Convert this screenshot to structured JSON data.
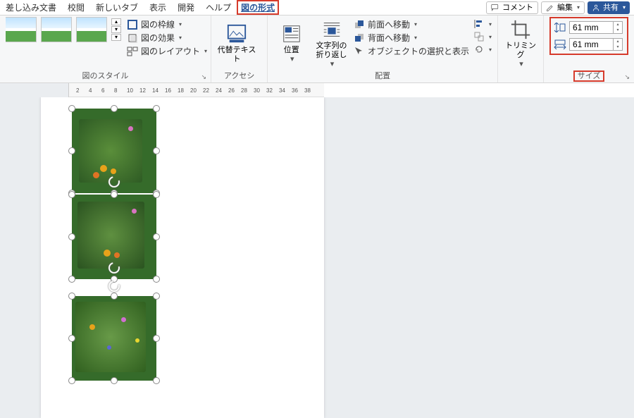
{
  "tabs": {
    "mailmerge": "差し込み文書",
    "review": "校閲",
    "newtab": "新しいタブ",
    "view": "表示",
    "dev": "開発",
    "help": "ヘルプ",
    "picformat": "図の形式"
  },
  "top_right": {
    "comment": "コメント",
    "edit": "編集",
    "share": "共有"
  },
  "styles": {
    "border": "図の枠線",
    "effects": "図の効果",
    "layout": "図のレイアウト",
    "group": "図のスタイル"
  },
  "alt": {
    "label": "代替テキスト"
  },
  "access": {
    "label": "アクセシビ…"
  },
  "arrange": {
    "position": "位置",
    "wrap": "文字列の折り返し",
    "forward": "前面へ移動",
    "backward": "背面へ移動",
    "selpane": "オブジェクトの選択と表示",
    "group": "配置"
  },
  "trim": {
    "label": "トリミング"
  },
  "size": {
    "height": "61 mm",
    "width": "61 mm",
    "group": "サイズ"
  },
  "ruler": [
    "2",
    "4",
    "6",
    "8",
    "10",
    "12",
    "14",
    "16",
    "18",
    "20",
    "22",
    "24",
    "26",
    "28",
    "30",
    "32",
    "34",
    "36",
    "38"
  ]
}
